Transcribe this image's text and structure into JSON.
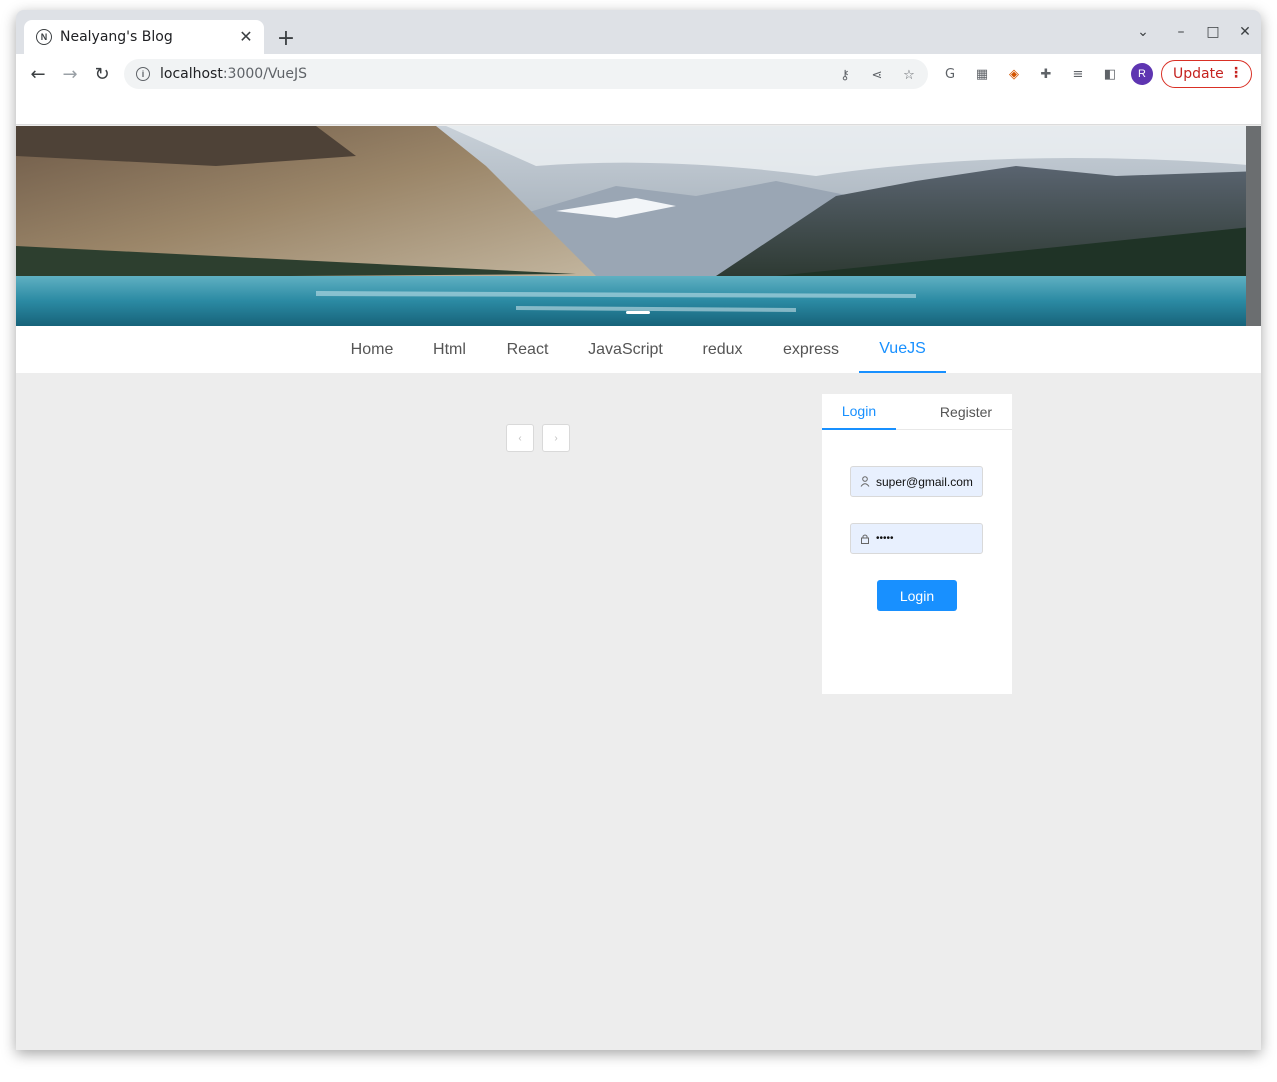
{
  "browser": {
    "tab_title": "Nealyang's Blog",
    "tab_close": "✕",
    "new_tab": "+",
    "url_host": "localhost",
    "url_path": ":3000/VueJS",
    "update_label": "Update",
    "avatar_letter": "R",
    "icons": [
      "back-icon",
      "forward-icon",
      "reload-icon",
      "info-icon",
      "key-icon",
      "share-icon",
      "star-icon",
      "google-icon",
      "qr-icon",
      "color-extension-icon",
      "puzzle-icon",
      "reading-list-icon",
      "side-panel-icon"
    ]
  },
  "nav": {
    "items": [
      {
        "label": "Home"
      },
      {
        "label": "Html"
      },
      {
        "label": "React"
      },
      {
        "label": "JavaScript"
      },
      {
        "label": "redux"
      },
      {
        "label": "express"
      },
      {
        "label": "VueJS",
        "active": true
      }
    ]
  },
  "pager": {
    "prev": "‹",
    "next": "›"
  },
  "login": {
    "tab_login": "Login",
    "tab_register": "Register",
    "email_value": "super@gmail.com",
    "password_value": "•••••",
    "submit_label": "Login"
  },
  "colors": {
    "accent": "#1890ff",
    "page_bg": "#ededed",
    "update_red": "#d93025",
    "avatar": "#5e35b1"
  }
}
